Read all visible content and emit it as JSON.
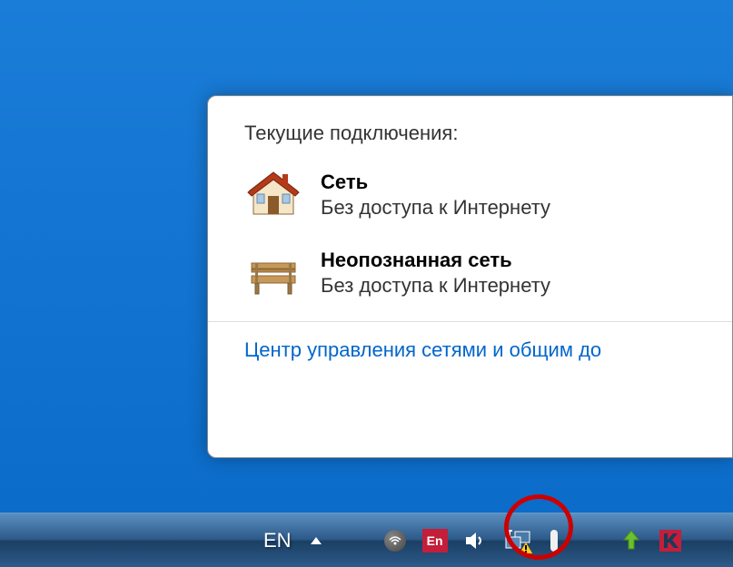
{
  "popup": {
    "title": "Текущие подключения:",
    "connections": [
      {
        "name": "Сеть",
        "status": "Без доступа к Интернету",
        "icon": "house-icon"
      },
      {
        "name": "Неопознанная сеть",
        "status": "Без доступа к Интернету",
        "icon": "bench-icon"
      }
    ],
    "link": "Центр управления сетями и общим до"
  },
  "taskbar": {
    "lang": "EN",
    "en_box": "En"
  }
}
